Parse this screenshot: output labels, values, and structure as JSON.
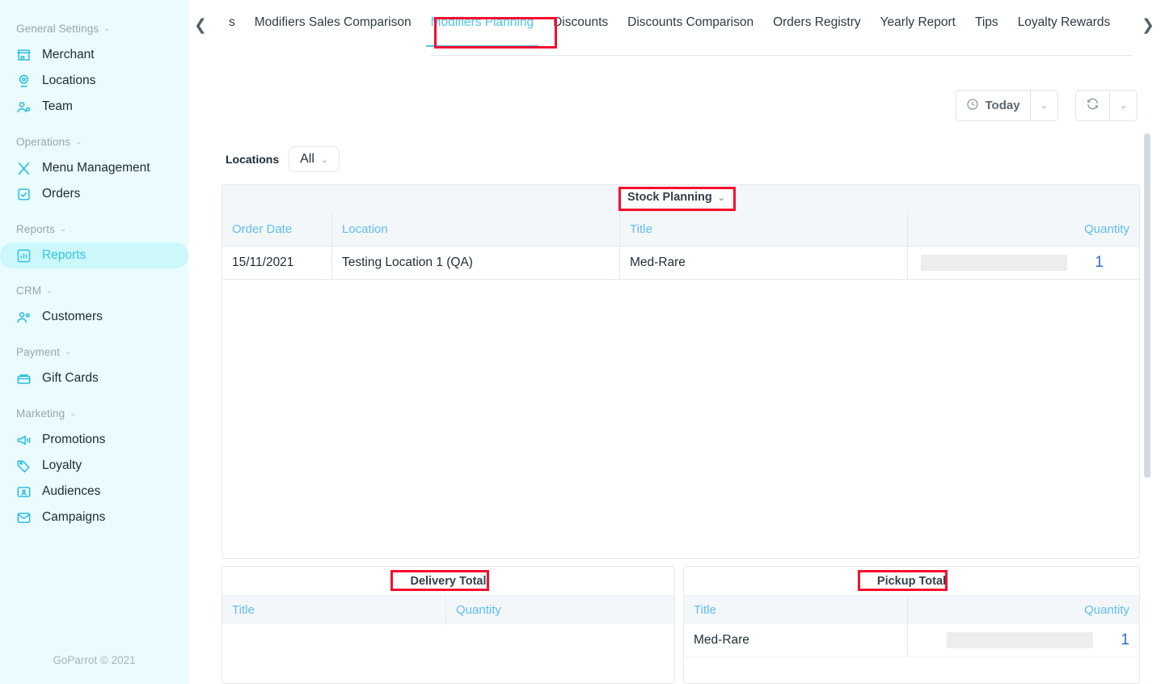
{
  "sidebar": {
    "groups": [
      {
        "title": "General Settings",
        "items": [
          {
            "label": "Merchant",
            "icon": "store-icon"
          },
          {
            "label": "Locations",
            "icon": "map-pin-icon"
          },
          {
            "label": "Team",
            "icon": "team-icon"
          }
        ]
      },
      {
        "title": "Operations",
        "items": [
          {
            "label": "Menu Management",
            "icon": "cutlery-icon"
          },
          {
            "label": "Orders",
            "icon": "clipboard-check-icon"
          }
        ]
      },
      {
        "title": "Reports",
        "items": [
          {
            "label": "Reports",
            "icon": "bar-chart-icon",
            "active": true
          }
        ]
      },
      {
        "title": "CRM",
        "items": [
          {
            "label": "Customers",
            "icon": "customers-icon"
          }
        ]
      },
      {
        "title": "Payment",
        "items": [
          {
            "label": "Gift Cards",
            "icon": "gift-card-icon"
          }
        ]
      },
      {
        "title": "Marketing",
        "items": [
          {
            "label": "Promotions",
            "icon": "megaphone-icon"
          },
          {
            "label": "Loyalty",
            "icon": "tag-icon"
          },
          {
            "label": "Audiences",
            "icon": "audience-icon"
          },
          {
            "label": "Campaigns",
            "icon": "envelope-icon"
          }
        ]
      }
    ],
    "footer": "GoParrot © 2021"
  },
  "tabs": {
    "scroll_left_icon": "chevron-left-icon",
    "scroll_right_icon": "chevron-right-icon",
    "items": [
      {
        "label": "s",
        "active": false,
        "partial": true
      },
      {
        "label": "Modifiers Sales Comparison",
        "active": false
      },
      {
        "label": "Modifiers Planning",
        "active": true
      },
      {
        "label": "Discounts",
        "active": false
      },
      {
        "label": "Discounts Comparison",
        "active": false
      },
      {
        "label": "Orders Registry",
        "active": false
      },
      {
        "label": "Yearly Report",
        "active": false
      },
      {
        "label": "Tips",
        "active": false
      },
      {
        "label": "Loyalty Rewards",
        "active": false
      }
    ]
  },
  "toolbar": {
    "date_range_label": "Today",
    "date_range_icon": "clock-icon",
    "date_range_chevron": "chevron-down-icon",
    "refresh_icon": "refresh-icon",
    "refresh_chevron": "chevron-down-icon"
  },
  "filters": {
    "locations_label": "Locations",
    "locations_value": "All",
    "locations_chevron": "chevron-down-icon"
  },
  "main_table": {
    "group_title": "Stock Planning",
    "group_chevron": "chevron-down-icon",
    "columns": [
      "Order Date",
      "Location",
      "Title",
      "Quantity"
    ],
    "rows": [
      {
        "order_date": "15/11/2021",
        "location": "Testing Location 1 (QA)",
        "title": "Med-Rare",
        "quantity": "1",
        "bar_fill_pct": 100
      }
    ]
  },
  "delivery_total": {
    "title": "Delivery Total",
    "columns": [
      "Title",
      "Quantity"
    ],
    "rows": []
  },
  "pickup_total": {
    "title": "Pickup Total",
    "columns": [
      "Title",
      "Quantity"
    ],
    "rows": [
      {
        "title": "Med-Rare",
        "quantity": "1",
        "bar_fill_pct": 100
      }
    ]
  },
  "annotations": {
    "color": "#f50f2e",
    "boxes": [
      "modifiers-planning-tab",
      "stock-planning-header",
      "delivery-total-header",
      "pickup-total-header"
    ]
  },
  "colors": {
    "sidebar_bg": "#eafcfd",
    "accent": "#4dc4ef",
    "header_text": "#5dbdf0",
    "quantity_number": "#2f6fd0",
    "annotation_red": "#f50f2e"
  }
}
